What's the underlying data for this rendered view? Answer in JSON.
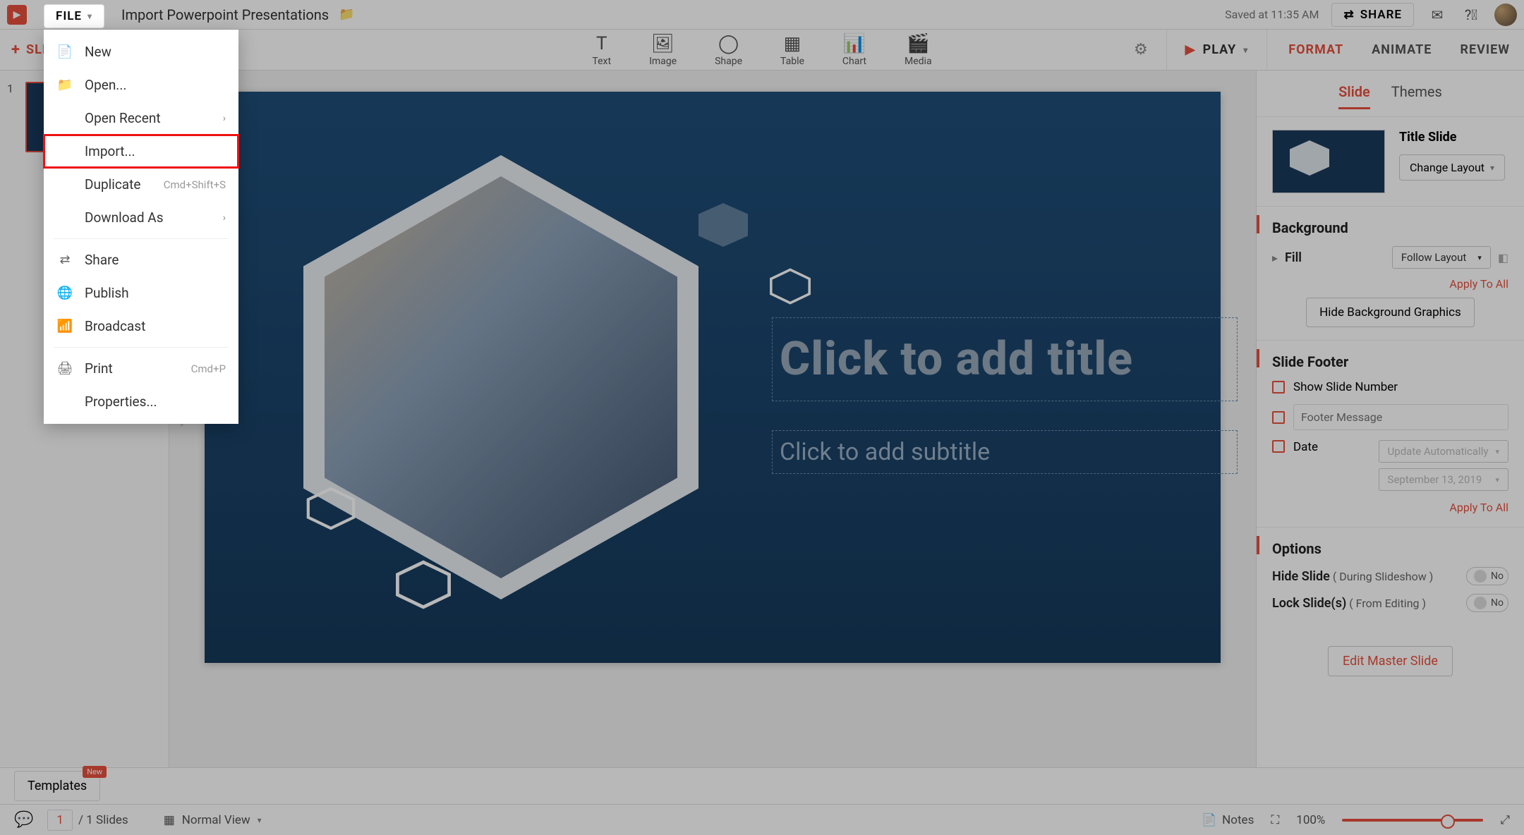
{
  "topbar": {
    "file_label": "FILE",
    "doc_title": "Import Powerpoint Presentations",
    "saved_at": "Saved at 11:35 AM",
    "share_label": "SHARE"
  },
  "toolbar": {
    "add_slide": "SLIDE",
    "items": [
      {
        "icon": "T",
        "label": "Text"
      },
      {
        "icon": "🖼",
        "label": "Image"
      },
      {
        "icon": "◯",
        "label": "Shape"
      },
      {
        "icon": "▦",
        "label": "Table"
      },
      {
        "icon": "📊",
        "label": "Chart"
      },
      {
        "icon": "🎬",
        "label": "Media"
      }
    ],
    "play_label": "PLAY",
    "right_tabs": [
      "FORMAT",
      "ANIMATE",
      "REVIEW"
    ],
    "right_tab_active": 0
  },
  "thumbs": {
    "slides": [
      {
        "num": "1"
      }
    ]
  },
  "canvas": {
    "title_placeholder": "Click to add title",
    "subtitle_placeholder": "Click to add subtitle"
  },
  "rpanel": {
    "subtabs": [
      "Slide",
      "Themes"
    ],
    "subtab_active": 0,
    "layout_name": "Title Slide",
    "change_layout": "Change Layout",
    "background_heading": "Background",
    "fill_label": "Fill",
    "fill_value": "Follow Layout",
    "apply_all": "Apply To All",
    "hide_bg_graphics": "Hide Background Graphics",
    "slide_footer_heading": "Slide Footer",
    "show_slide_number": "Show Slide Number",
    "footer_placeholder": "Footer Message",
    "date_label": "Date",
    "date_update": "Update Automatically",
    "date_value": "September 13, 2019",
    "options_heading": "Options",
    "hide_slide": "Hide Slide",
    "hide_slide_hint": "( During Slideshow )",
    "lock_slides": "Lock Slide(s)",
    "lock_slides_hint": "( From Editing )",
    "toggle_no": "No",
    "edit_master": "Edit Master Slide"
  },
  "bottombar": {
    "templates": "Templates",
    "templates_badge": "New",
    "page_current": "1",
    "page_total": "/ 1 Slides",
    "view": "Normal View",
    "notes": "Notes",
    "zoom": "100%"
  },
  "file_menu": {
    "items": [
      {
        "icon": "📄",
        "label": "New"
      },
      {
        "icon": "📁",
        "label": "Open..."
      },
      {
        "icon": "",
        "label": "Open Recent",
        "submenu": true
      },
      {
        "icon": "",
        "label": "Import...",
        "highlight": true
      },
      {
        "icon": "",
        "label": "Duplicate",
        "shortcut": "Cmd+Shift+S"
      },
      {
        "icon": "",
        "label": "Download As",
        "submenu": true
      },
      {
        "divider": true
      },
      {
        "icon": "share",
        "label": "Share"
      },
      {
        "icon": "publish",
        "label": "Publish"
      },
      {
        "icon": "broadcast",
        "label": "Broadcast"
      },
      {
        "divider": true
      },
      {
        "icon": "🖨",
        "label": "Print",
        "shortcut": "Cmd+P"
      },
      {
        "icon": "",
        "label": "Properties..."
      }
    ]
  }
}
